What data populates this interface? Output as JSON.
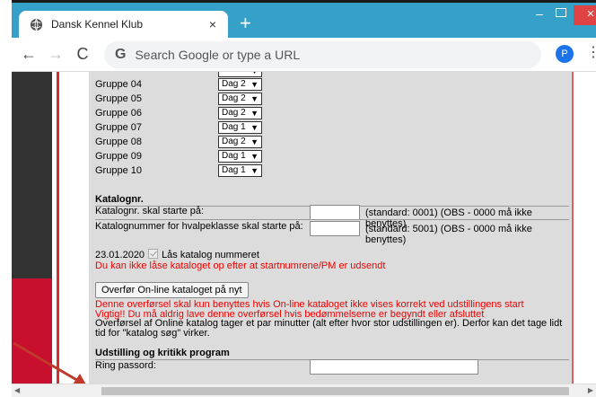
{
  "browser": {
    "tab_title": "Dansk Kennel Klub",
    "tab_close": "×",
    "new_tab": "+",
    "omnibox_placeholder": "Search Google or type a URL",
    "profile_initial": "P",
    "window_min": "–",
    "window_close": "×",
    "theme_color": "#35a0c8"
  },
  "groups": [
    {
      "label": "Gruppe 04",
      "day": "Dag 2"
    },
    {
      "label": "Gruppe 05",
      "day": "Dag 2"
    },
    {
      "label": "Gruppe 06",
      "day": "Dag 2"
    },
    {
      "label": "Gruppe 07",
      "day": "Dag 1"
    },
    {
      "label": "Gruppe 08",
      "day": "Dag 2"
    },
    {
      "label": "Gruppe 09",
      "day": "Dag 1"
    },
    {
      "label": "Gruppe 10",
      "day": "Dag 1"
    }
  ],
  "katalog": {
    "heading": "Katalognr.",
    "start_label": "Katalognr. skal starte på:",
    "start_value": "",
    "start_hint": "(standard: 0001) (OBS - 0000 må ikke benyttes)",
    "puppy_label": "Katalognummer for hvalpeklasse skal starte på:",
    "puppy_value": "",
    "puppy_hint": "(standard: 5001) (OBS - 0000 må ikke benyttes)",
    "lock_date": "23.01.2020",
    "lock_label": "Lås katalog nummeret",
    "lock_warning": "Du kan ikke låse kataloget op efter at startnumrene/PM er udsendt",
    "transfer_button": "Overfør On-line kataloget på nyt",
    "transfer_warning_1": "Denne overførsel skal kun benyttes hvis On-line kataloget ikke vises korrekt ved udstillingens start",
    "transfer_warning_2": "Vigtig!! Du må aldrig lave denne overførsel hvis bedømmelserne er begyndt eller afsluttet",
    "transfer_info": "Overførsel af Online katalog tager et par minutter (alt efter hvor stor udstillingen er). Derfor kan det tage lidt tid for \"katalog søg\" virker."
  },
  "program": {
    "heading": "Udstilling og kritikk program",
    "ring_label": "Ring passord:",
    "ring_value": ""
  },
  "colors": {
    "warning": "#ee0000",
    "panel_bg": "#dcdcdc",
    "annotation_arrow": "#c0392b"
  }
}
